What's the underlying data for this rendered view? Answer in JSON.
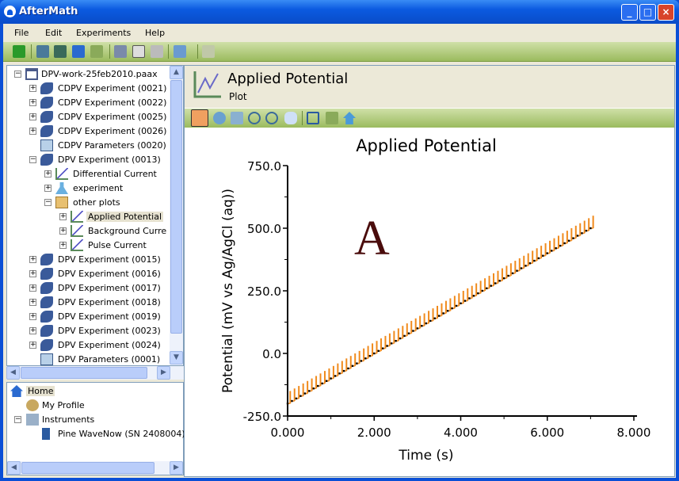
{
  "window": {
    "title": "AfterMath",
    "buttons": [
      "_",
      "□",
      "×"
    ]
  },
  "menu": [
    "File",
    "Edit",
    "Experiments",
    "Help"
  ],
  "toolbar": {
    "icons": [
      "back-icon",
      "new-archive-icon",
      "open-archive-icon",
      "save-icon",
      "print-icon",
      "cut-icon",
      "copy-icon",
      "paste-icon",
      "run-experiment-icon",
      "disabled-icon"
    ]
  },
  "tree": {
    "root": "DPV-work-25feb2010.paax",
    "items": [
      {
        "label": "CDPV Experiment (0021)",
        "level": 1,
        "exp": "+",
        "icon": "experiment"
      },
      {
        "label": "CDPV Experiment (0022)",
        "level": 1,
        "exp": "+",
        "icon": "experiment"
      },
      {
        "label": "CDPV Experiment (0025)",
        "level": 1,
        "exp": "+",
        "icon": "experiment"
      },
      {
        "label": "CDPV Experiment (0026)",
        "level": 1,
        "exp": "+",
        "icon": "experiment"
      },
      {
        "label": "CDPV Parameters (0020)",
        "level": 1,
        "exp": "",
        "icon": "parameters"
      },
      {
        "label": "DPV Experiment (0013)",
        "level": 1,
        "exp": "-",
        "icon": "experiment"
      },
      {
        "label": "Differential Current",
        "level": 2,
        "exp": "+",
        "icon": "plot"
      },
      {
        "label": "experiment",
        "level": 2,
        "exp": "+",
        "icon": "flask"
      },
      {
        "label": "other plots",
        "level": 2,
        "exp": "-",
        "icon": "folder"
      },
      {
        "label": "Applied Potential",
        "level": 3,
        "exp": "+",
        "icon": "plot",
        "selected": true
      },
      {
        "label": "Background Curre",
        "level": 3,
        "exp": "+",
        "icon": "plot"
      },
      {
        "label": "Pulse Current",
        "level": 3,
        "exp": "+",
        "icon": "plot"
      },
      {
        "label": "DPV Experiment (0015)",
        "level": 1,
        "exp": "+",
        "icon": "experiment"
      },
      {
        "label": "DPV Experiment (0016)",
        "level": 1,
        "exp": "+",
        "icon": "experiment"
      },
      {
        "label": "DPV Experiment (0017)",
        "level": 1,
        "exp": "+",
        "icon": "experiment"
      },
      {
        "label": "DPV Experiment (0018)",
        "level": 1,
        "exp": "+",
        "icon": "experiment"
      },
      {
        "label": "DPV Experiment (0019)",
        "level": 1,
        "exp": "+",
        "icon": "experiment"
      },
      {
        "label": "DPV Experiment (0023)",
        "level": 1,
        "exp": "+",
        "icon": "experiment"
      },
      {
        "label": "DPV Experiment (0024)",
        "level": 1,
        "exp": "+",
        "icon": "experiment"
      },
      {
        "label": "DPV Parameters (0001)",
        "level": 1,
        "exp": "",
        "icon": "parameters"
      }
    ]
  },
  "home_tree": {
    "home": "Home",
    "profile": "My Profile",
    "instruments": "Instruments",
    "instrument": "Pine WaveNow (SN 2408004)"
  },
  "header": {
    "title": "Applied Potential",
    "subtitle": "Plot"
  },
  "plot_toolbar": {
    "icons": [
      "select-arrow-icon",
      "select-point-icon",
      "select-region-icon",
      "zoom-in-icon",
      "zoom-out-icon",
      "pan-hand-icon",
      "zoom-fit-icon",
      "print-icon",
      "home-icon"
    ]
  },
  "colors": {
    "pulse": "#f08a1c",
    "baseline": "#000000",
    "annotation": "#4a0c0c",
    "accent": "#9bbb5e"
  },
  "chart_data": {
    "type": "line",
    "title": "Applied Potential",
    "xlabel": "Time (s)",
    "ylabel": "Potential (mV vs Ag/AgCl (aq))",
    "annotation": "A",
    "xlim": [
      0,
      8
    ],
    "ylim": [
      -250,
      750
    ],
    "xticks": [
      "0.000",
      "2.000",
      "4.000",
      "6.000",
      "8.000"
    ],
    "yticks": [
      "-250.0",
      "0.0",
      "250.0",
      "500.0",
      "750.0"
    ],
    "grid": false,
    "x": [
      0,
      0.1,
      0.2,
      0.3,
      0.4,
      0.5,
      0.6,
      0.7,
      0.8,
      0.9,
      1,
      1.1,
      1.2,
      1.3,
      1.4,
      1.5,
      1.6,
      1.7,
      1.8,
      1.9,
      2,
      2.1,
      2.2,
      2.3,
      2.4,
      2.5,
      2.6,
      2.7,
      2.8,
      2.9,
      3,
      3.1,
      3.2,
      3.3,
      3.4,
      3.5,
      3.6,
      3.7,
      3.8,
      3.9,
      4,
      4.1,
      4.2,
      4.3,
      4.4,
      4.5,
      4.6,
      4.7,
      4.8,
      4.9,
      5,
      5.1,
      5.2,
      5.3,
      5.4,
      5.5,
      5.6,
      5.7,
      5.8,
      5.9,
      6,
      6.1,
      6.2,
      6.3,
      6.4,
      6.5,
      6.6,
      6.7,
      6.8,
      6.9,
      7
    ],
    "series": [
      {
        "values": [
          -200,
          -190,
          -180,
          -170,
          -160,
          -150,
          -140,
          -130,
          -120,
          -110,
          -100,
          -90,
          -80,
          -70,
          -60,
          -50,
          -40,
          -30,
          -20,
          -10,
          0,
          10,
          20,
          30,
          40,
          50,
          60,
          70,
          80,
          90,
          100,
          110,
          120,
          130,
          140,
          150,
          160,
          170,
          180,
          190,
          200,
          210,
          220,
          230,
          240,
          250,
          260,
          270,
          280,
          290,
          300,
          310,
          320,
          330,
          340,
          350,
          360,
          370,
          380,
          390,
          400,
          410,
          420,
          430,
          440,
          450,
          460,
          470,
          480,
          490,
          500
        ]
      },
      {
        "values": [
          -150,
          -140,
          -130,
          -120,
          -110,
          -100,
          -90,
          -80,
          -70,
          -60,
          -50,
          -40,
          -30,
          -20,
          -10,
          0,
          10,
          20,
          30,
          40,
          50,
          60,
          70,
          80,
          90,
          100,
          110,
          120,
          130,
          140,
          150,
          160,
          170,
          180,
          190,
          200,
          210,
          220,
          230,
          240,
          250,
          260,
          270,
          280,
          290,
          300,
          310,
          320,
          330,
          340,
          350,
          360,
          370,
          380,
          390,
          400,
          410,
          420,
          430,
          440,
          450,
          460,
          470,
          480,
          490,
          500,
          510,
          520,
          530,
          540,
          550
        ]
      }
    ]
  }
}
